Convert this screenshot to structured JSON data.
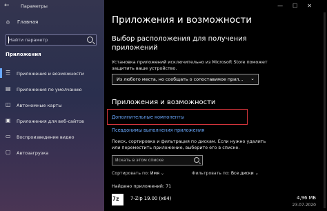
{
  "window": {
    "back_glyph": "←",
    "title": "Параметры",
    "controls": [
      "—",
      "☐",
      "✕"
    ]
  },
  "sidebar": {
    "home": {
      "icon": "home-icon",
      "glyph": "⌂",
      "label": "Главная"
    },
    "search": {
      "placeholder": "Найти параметр"
    },
    "section_title": "Приложения",
    "items": [
      {
        "icon": "apps-list-icon",
        "glyph": "☰",
        "label": "Приложения и возможности",
        "active": true
      },
      {
        "icon": "default-apps-icon",
        "glyph": "▤",
        "label": "Приложения по умолчанию"
      },
      {
        "icon": "offline-maps-icon",
        "glyph": "◫",
        "label": "Автономные карты"
      },
      {
        "icon": "websites-apps-icon",
        "glyph": "▣",
        "label": "Приложения для веб-сайтов"
      },
      {
        "icon": "video-playback-icon",
        "glyph": "▭",
        "label": "Воспроизведение видео"
      },
      {
        "icon": "startup-icon",
        "glyph": "▢",
        "label": "Автозагрузка"
      }
    ]
  },
  "main": {
    "page_title": "Приложения и возможности",
    "install_section": {
      "heading": "Выбор расположения для получения приложений",
      "description": "Установка приложений исключительно из Microsoft Store поможет защитить ваше устройство.",
      "dropdown_value": "Из любого места, но сообщать о сопоставимое прил..."
    },
    "apps_section": {
      "heading": "Приложения и возможности",
      "optional_features_link": "Дополнительные компоненты",
      "aliases_link": "Псевдонимы выполнения приложения",
      "description": "Поиск, сортировка и фильтрация по дискам. Если нужно удалить или переместить приложение, выберите его в списке.",
      "search_placeholder": "Искать в этом списке",
      "sort_label": "Сортировать по:",
      "sort_value": "Имя",
      "filter_label": "Фильтровать по:",
      "filter_value": "Все диски",
      "found_count": "Найдено приложений: 71",
      "apps": [
        {
          "icon_text": "7z",
          "name": "7-Zip 19.00 (x64)",
          "size": "4,96 МБ",
          "date": "23.07.2020"
        }
      ]
    }
  }
}
